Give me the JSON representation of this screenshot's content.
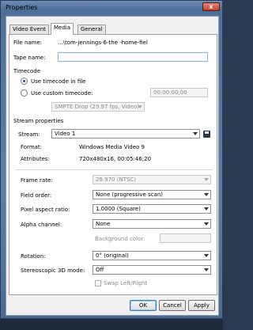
{
  "window": {
    "title": "Properties",
    "close_glyph": "x"
  },
  "tabs": [
    {
      "label": "Video Event",
      "active": false
    },
    {
      "label": "Media",
      "active": true
    },
    {
      "label": "General",
      "active": false
    }
  ],
  "file": {
    "label": "File name:",
    "value": "...\\tom-jennings-6-the -home-fiel"
  },
  "tape": {
    "label": "Tape name:",
    "value": ""
  },
  "timecode": {
    "header": "Timecode",
    "use_file_label": "Use timecode in file",
    "use_custom_label": "Use custom timecode:",
    "custom_value": "00:00:00;00",
    "format": "SMPTE Drop (29.97 fps, Video)"
  },
  "stream": {
    "header": "Stream properties",
    "label": "Stream:",
    "value": "Video 1",
    "format_label": "Format:",
    "format_value": "Windows Media Video 9",
    "attributes_label": "Attributes:",
    "attributes_value": "720x480x16, 00:05:46;20"
  },
  "props": {
    "frame_rate_label": "Frame rate:",
    "frame_rate_value": "29.970 (NTSC)",
    "field_order_label": "Field order:",
    "field_order_value": "None (progressive scan)",
    "pixel_aspect_label": "Pixel aspect ratio:",
    "pixel_aspect_value": "1.0000 (Square)",
    "alpha_label": "Alpha channel:",
    "alpha_value": "None",
    "bg_color_label": "Background color:",
    "rotation_label": "Rotation:",
    "rotation_value": "0° (original)",
    "stereo_label": "Stereoscopic 3D mode:",
    "stereo_value": "Off",
    "swap_label": "Swap Left/Right"
  },
  "buttons": {
    "ok": "OK",
    "cancel": "Cancel",
    "apply": "Apply"
  }
}
